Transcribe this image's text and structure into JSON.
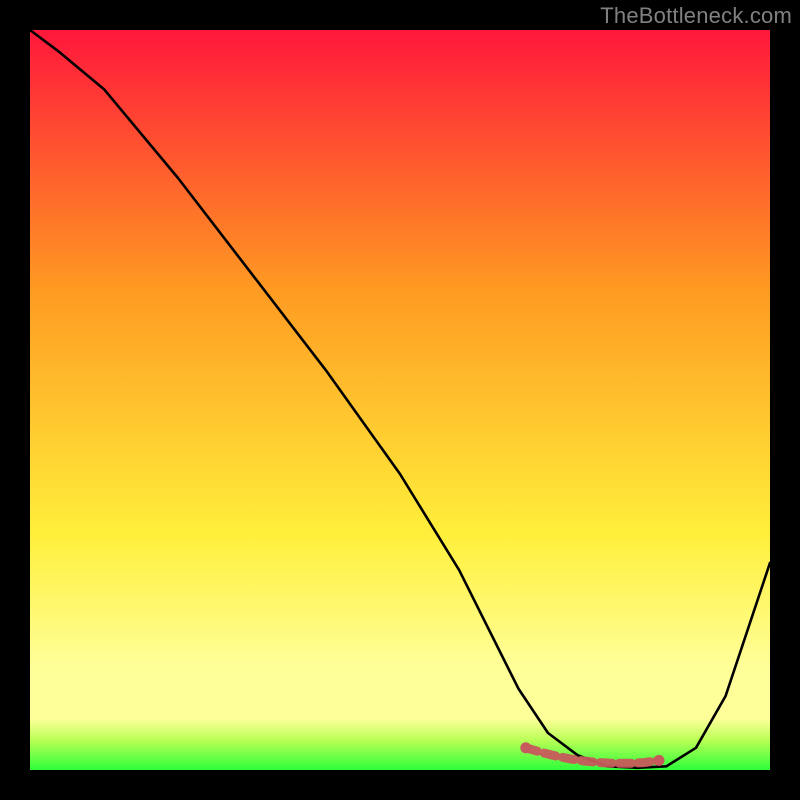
{
  "watermark": "TheBottleneck.com",
  "plot": {
    "outer_w": 800,
    "outer_h": 800,
    "inner_x": 30,
    "inner_y": 30,
    "inner_w": 740,
    "inner_h": 740
  },
  "colors": {
    "bg": "#000000",
    "grad_top": "#ff173b",
    "grad_mid1": "#ff9a22",
    "grad_mid2": "#ffef3a",
    "grad_band": "#ffff99",
    "grad_bottom": "#2dff3a",
    "curve": "#000000",
    "marker_stroke": "#c75a5c",
    "marker_fill": "#c75a5c"
  },
  "chart_data": {
    "type": "line",
    "title": "",
    "xlabel": "",
    "ylabel": "",
    "xlim": [
      0,
      100
    ],
    "ylim": [
      0,
      100
    ],
    "series": [
      {
        "name": "curve",
        "x": [
          0,
          4,
          10,
          20,
          30,
          40,
          50,
          58,
          62,
          66,
          70,
          74,
          78,
          82,
          86,
          90,
          94,
          100
        ],
        "values": [
          100,
          97,
          92,
          80,
          67,
          54,
          40,
          27,
          19,
          11,
          5,
          2,
          0.5,
          0.3,
          0.5,
          3,
          10,
          28
        ]
      },
      {
        "name": "highlight-markers",
        "x": [
          67,
          69,
          71,
          73,
          75,
          77,
          79,
          81,
          83,
          85
        ],
        "values": [
          3,
          2.4,
          1.9,
          1.5,
          1.2,
          1.0,
          0.9,
          0.9,
          1.0,
          1.3
        ]
      }
    ]
  }
}
